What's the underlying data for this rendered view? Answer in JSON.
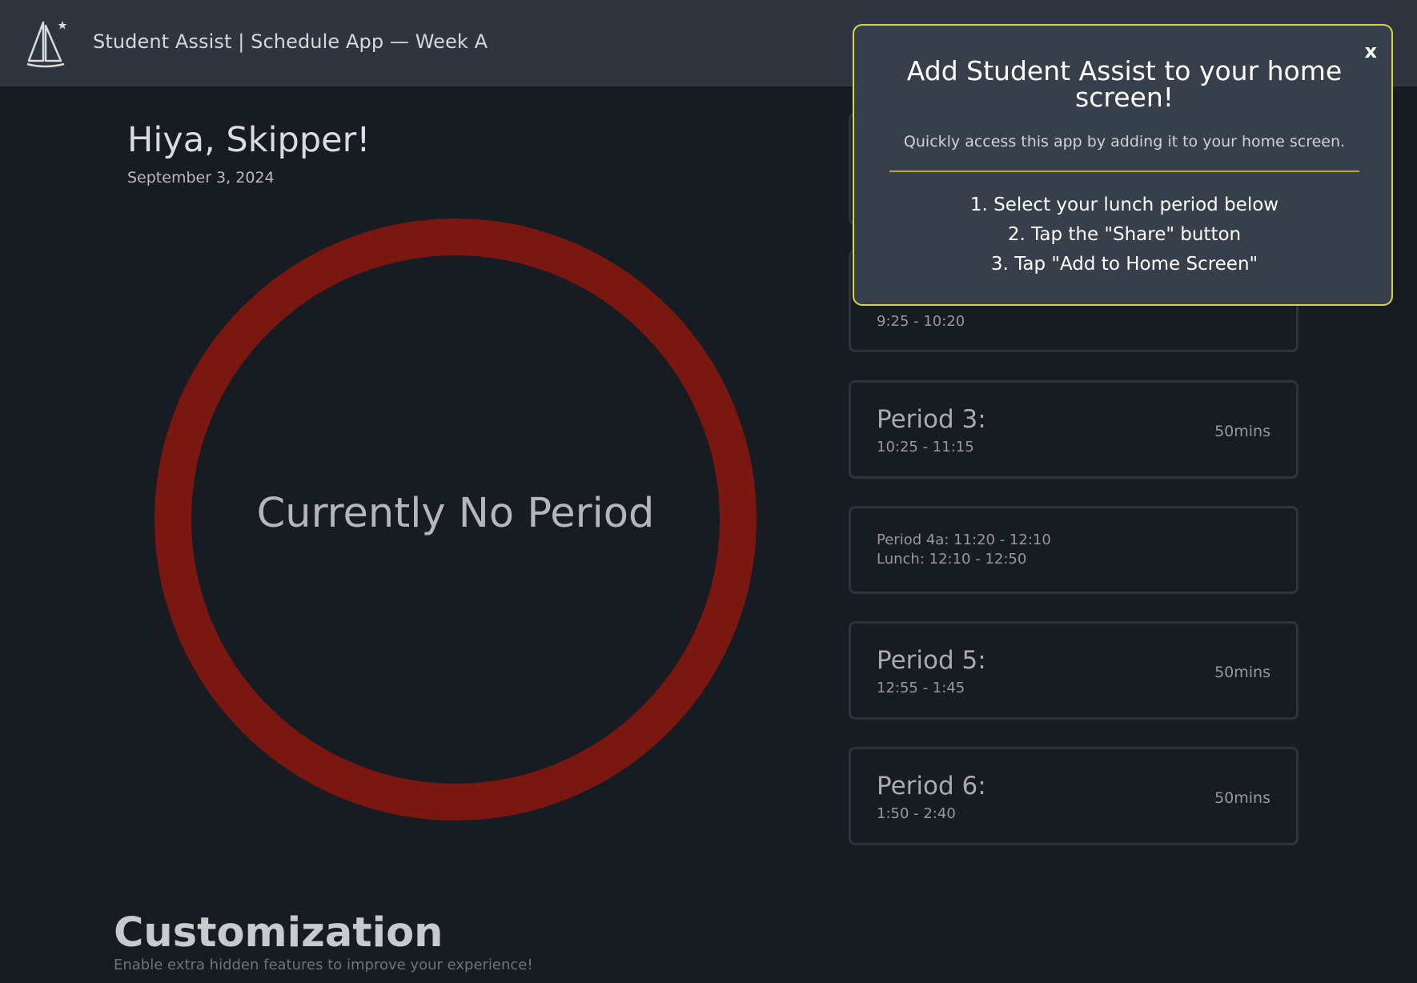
{
  "header": {
    "title": "Student Assist | Schedule App — Week A",
    "logo_icon": "sailboat-icon"
  },
  "main": {
    "greeting": "Hiya, Skipper!",
    "date": "September 3, 2024",
    "status_text": "Currently No Period",
    "ring_color": "#7a1710"
  },
  "schedule": {
    "period2": {
      "time": "9:25 - 10:20"
    },
    "period3": {
      "name": "Period 3:",
      "time": "10:25 - 11:15",
      "duration": "50mins"
    },
    "period4": {
      "line1": "Period 4a: 11:20 - 12:10",
      "line2": "Lunch: 12:10 - 12:50"
    },
    "period5": {
      "name": "Period 5:",
      "time": "12:55 - 1:45",
      "duration": "50mins"
    },
    "period6": {
      "name": "Period 6:",
      "time": "1:50 - 2:40",
      "duration": "50mins"
    }
  },
  "customization": {
    "title": "Customization",
    "subtitle": "Enable extra hidden features to improve your experience!"
  },
  "popup": {
    "close_label": "x",
    "title": "Add Student Assist to your home screen!",
    "description": "Quickly access this app by adding it to your home screen.",
    "steps": [
      "1. Select your lunch period below",
      "2. Tap the \"Share\" button",
      "3. Tap \"Add to Home Screen\""
    ],
    "border_color": "#d8d44a"
  }
}
